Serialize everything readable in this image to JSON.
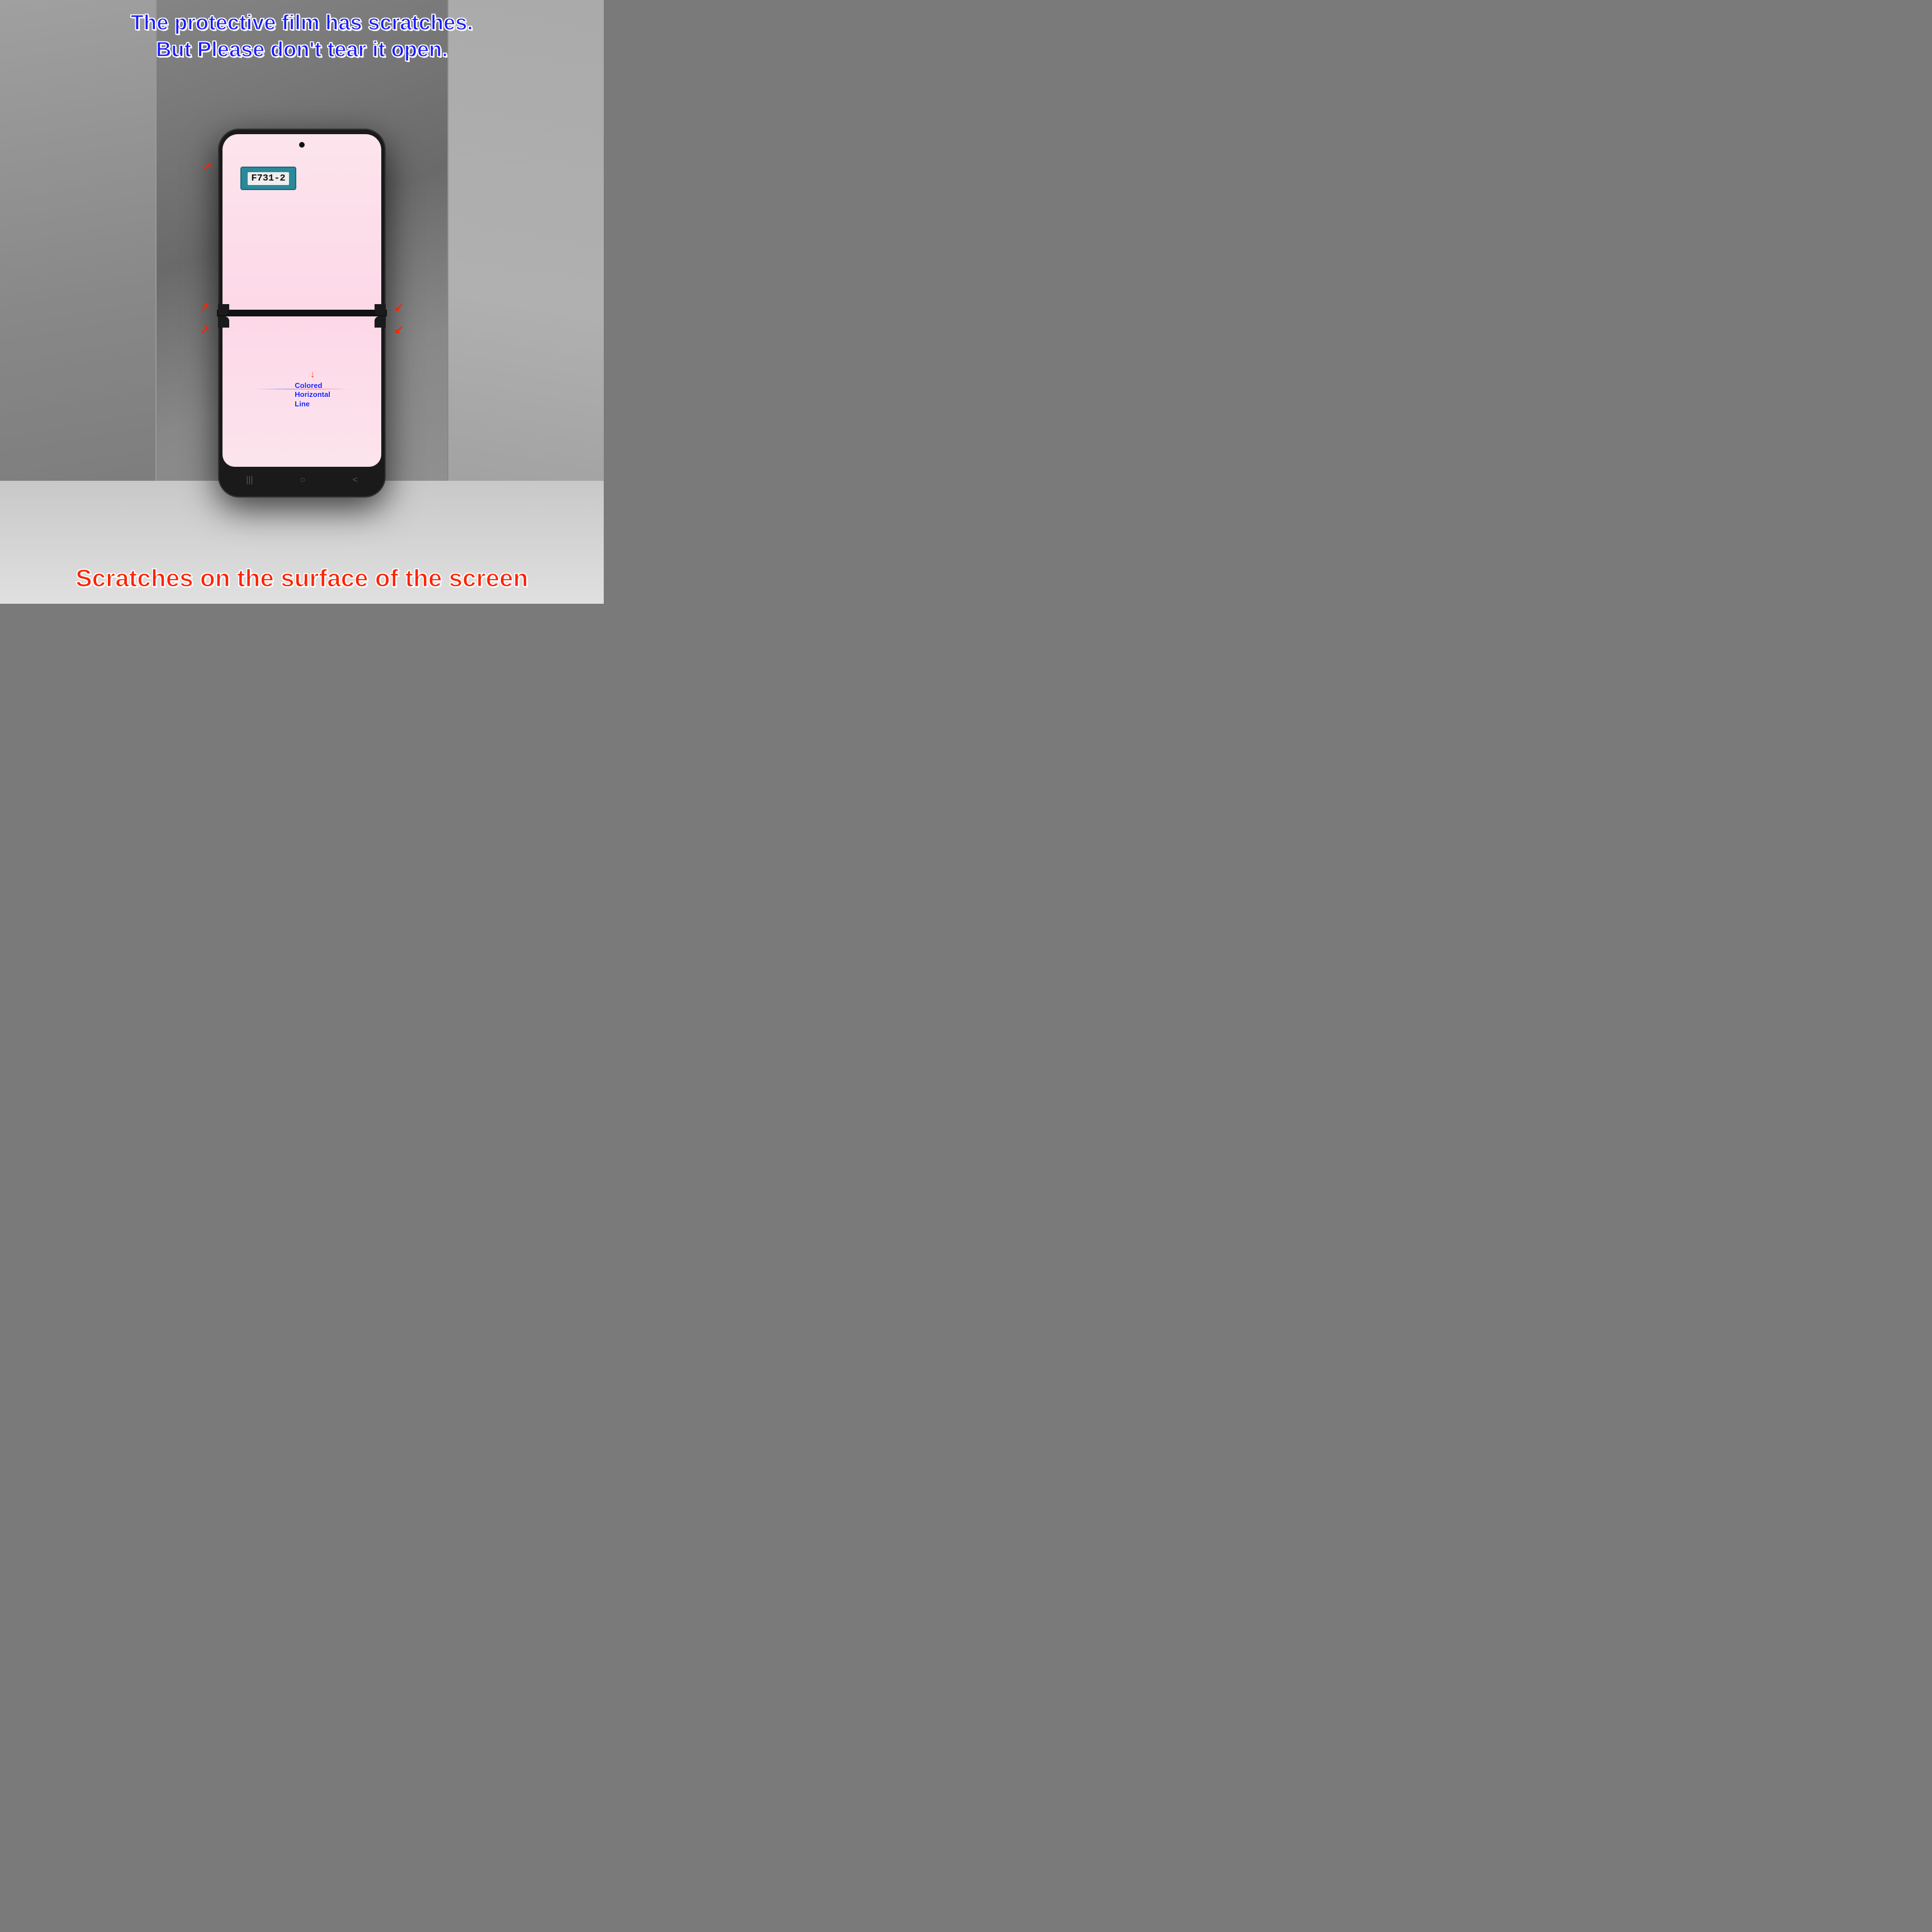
{
  "top_text": {
    "line1": "The protective film has scratches.",
    "line2": "But Please don't tear it open."
  },
  "bottom_text": {
    "line1": "Scratches on the surface of the screen"
  },
  "phone": {
    "label": "F731-2",
    "colored_line_label": {
      "line1": "Colored",
      "line2": "Horizontal",
      "line3": "Line"
    }
  },
  "nav": {
    "recent_icon": "|||",
    "home_icon": "○",
    "back_icon": "<"
  },
  "arrows": [
    {
      "id": "arrow-top-left",
      "symbol": "↗"
    },
    {
      "id": "arrow-top-right",
      "symbol": "↙"
    },
    {
      "id": "arrow-mid-left",
      "symbol": "↗"
    },
    {
      "id": "arrow-mid-right",
      "symbol": "↙"
    },
    {
      "id": "arrow-colored-line",
      "symbol": "↓"
    }
  ]
}
